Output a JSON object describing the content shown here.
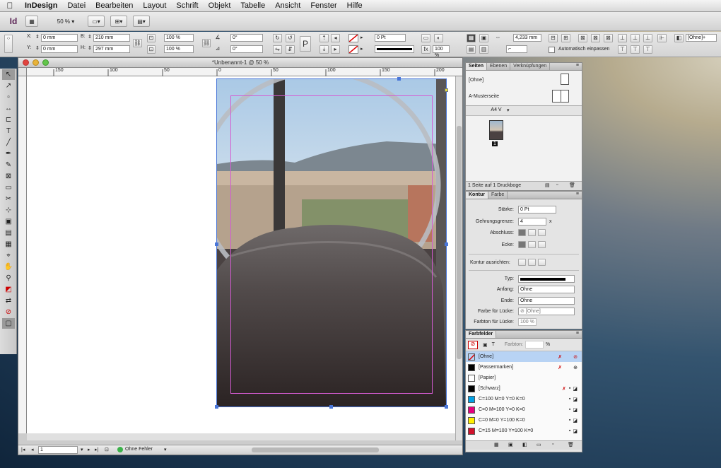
{
  "menubar": {
    "app_name": "InDesign",
    "items": [
      "Datei",
      "Bearbeiten",
      "Layout",
      "Schrift",
      "Objekt",
      "Tabelle",
      "Ansicht",
      "Fenster",
      "Hilfe"
    ]
  },
  "appbar": {
    "logo": "Id",
    "zoom": "50 %"
  },
  "control": {
    "x_label": "X:",
    "x_value": "0 mm",
    "y_label": "Y:",
    "y_value": "0 mm",
    "w_label": "B:",
    "w_value": "210 mm",
    "h_label": "H:",
    "h_value": "297 mm",
    "scale_x": "100 %",
    "scale_y": "100 %",
    "angle": "0°",
    "shear": "0°",
    "stroke_weight": "0 Pt",
    "gap_value": "4,233 mm",
    "tint": "100 %",
    "autofit_label": "Automatisch einpassen",
    "style_select": "[Ohne]+"
  },
  "document": {
    "title": "*Unbenannt-1 @ 50 %",
    "ruler_labels": [
      "150",
      "100",
      "50",
      "0",
      "50",
      "100",
      "150",
      "200"
    ],
    "page_field": "1",
    "preflight": "Ohne Fehler"
  },
  "pages_panel": {
    "tabs": [
      "Seiten",
      "Ebenen",
      "Verknüpfungen"
    ],
    "none_label": "[Ohne]",
    "master_label": "A-Musterseite",
    "size_select": "A4 V",
    "page_number": "1",
    "footer": "1 Seite auf 1 Druckboge"
  },
  "stroke_panel": {
    "tabs": [
      "Kontur",
      "Farbe"
    ],
    "weight_label": "Stärke:",
    "weight_value": "0 Pt",
    "miter_label": "Gehrungsgrenze:",
    "miter_value": "4",
    "miter_unit": "x",
    "cap_label": "Abschluss:",
    "corner_label": "Ecke:",
    "align_label": "Kontur ausrichten:",
    "type_label": "Typ:",
    "start_label": "Anfang:",
    "start_value": "Ohne",
    "end_label": "Ende:",
    "end_value": "Ohne",
    "gapcolor_label": "Farbe für Lücke:",
    "gapcolor_value": "[Ohne]",
    "gaptint_label": "Farbton für Lücke:",
    "gaptint_value": "100 %"
  },
  "swatches_panel": {
    "title": "Farbfelder",
    "tint_label": "Farbton:",
    "tint_unit": "%",
    "items": [
      {
        "name": "[Ohne]",
        "color": "#ffffff"
      },
      {
        "name": "[Passermarken]",
        "color": "#000000"
      },
      {
        "name": "[Papier]",
        "color": "#ffffff"
      },
      {
        "name": "[Schwarz]",
        "color": "#000000"
      },
      {
        "name": "C=100 M=0 Y=0 K=0",
        "color": "#00a0e4"
      },
      {
        "name": "C=0 M=100 Y=0 K=0",
        "color": "#e4007c"
      },
      {
        "name": "C=0 M=0 Y=100 K=0",
        "color": "#ffee00"
      },
      {
        "name": "C=15 M=100 Y=100 K=0",
        "color": "#d0112b"
      }
    ]
  }
}
